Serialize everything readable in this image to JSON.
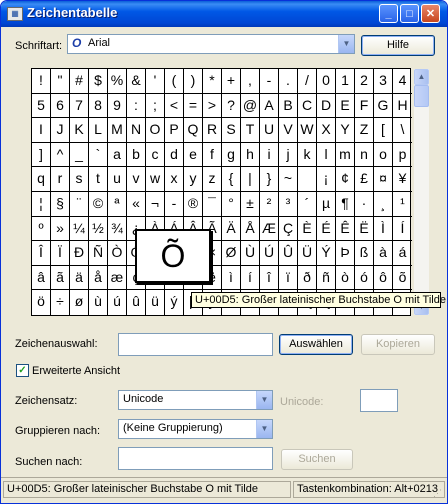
{
  "window": {
    "title": "Zeichentabelle"
  },
  "font_row": {
    "label": "Schriftart:",
    "font_icon": "O",
    "value": "Arial",
    "help_button": "Hilfe"
  },
  "grid": {
    "rows": [
      [
        "!",
        "\"",
        "#",
        "$",
        "%",
        "&",
        "'",
        "(",
        ")",
        "*",
        "+",
        ",",
        "-",
        ".",
        "/",
        "0",
        "1",
        "2",
        "3",
        "4"
      ],
      [
        "5",
        "6",
        "7",
        "8",
        "9",
        ":",
        ";",
        "<",
        "=",
        ">",
        "?",
        "@",
        "A",
        "B",
        "C",
        "D",
        "E",
        "F",
        "G",
        "H"
      ],
      [
        "I",
        "J",
        "K",
        "L",
        "M",
        "N",
        "O",
        "P",
        "Q",
        "R",
        "S",
        "T",
        "U",
        "V",
        "W",
        "X",
        "Y",
        "Z",
        "[",
        "\\"
      ],
      [
        "]",
        "^",
        "_",
        "`",
        "a",
        "b",
        "c",
        "d",
        "e",
        "f",
        "g",
        "h",
        "i",
        "j",
        "k",
        "l",
        "m",
        "n",
        "o",
        "p"
      ],
      [
        "q",
        "r",
        "s",
        "t",
        "u",
        "v",
        "w",
        "x",
        "y",
        "z",
        "{",
        "|",
        "}",
        "~",
        "",
        "¡",
        "¢",
        "£",
        "¤",
        "¥"
      ],
      [
        "¦",
        "§",
        "¨",
        "©",
        "ª",
        "«",
        "¬",
        "-",
        "®",
        "¯",
        "°",
        "±",
        "²",
        "³",
        "´",
        "µ",
        "¶",
        "·",
        "¸",
        "¹"
      ],
      [
        "º",
        "»",
        "¼",
        "½",
        "¾",
        "¿",
        "À",
        "Á",
        "Â",
        "Ã",
        "Ä",
        "Å",
        "Æ",
        "Ç",
        "È",
        "É",
        "Ê",
        "Ë",
        "Ì",
        "Í"
      ],
      [
        "Î",
        "Ï",
        "Ð",
        "Ñ",
        "Ò",
        "Ó",
        "Ô",
        "Õ",
        "Ö",
        "×",
        "Ø",
        "Ù",
        "Ú",
        "Û",
        "Ü",
        "Ý",
        "Þ",
        "ß",
        "à",
        "á"
      ],
      [
        "â",
        "ã",
        "ä",
        "å",
        "æ",
        "ç",
        "è",
        "é",
        "ê",
        "ë",
        "ì",
        "í",
        "î",
        "ï",
        "ð",
        "ñ",
        "ò",
        "ó",
        "ô",
        "õ"
      ],
      [
        "ö",
        "÷",
        "ø",
        "ù",
        "ú",
        "û",
        "ü",
        "ý",
        "þ",
        "ÿ",
        "Ā",
        "ā",
        "Ă",
        "ă",
        "Ą",
        "ą",
        "Ć",
        "ć",
        "Ĉ",
        "ĉ"
      ]
    ],
    "magnified_char": "Õ",
    "tooltip": "U+00D5: Großer lateinischer Buchstabe O mit Tilde"
  },
  "selection": {
    "label": "Zeichenauswahl:",
    "value": "",
    "select_button": "Auswählen",
    "copy_button": "Kopieren"
  },
  "advanced": {
    "label": "Erweiterte Ansicht",
    "checked": true
  },
  "charset": {
    "label": "Zeichensatz:",
    "value": "Unicode",
    "unicode_label": "Unicode:",
    "unicode_value": ""
  },
  "group": {
    "label": "Gruppieren nach:",
    "value": "(Keine Gruppierung)"
  },
  "search": {
    "label": "Suchen nach:",
    "value": "",
    "button": "Suchen"
  },
  "status": {
    "left": "U+00D5: Großer lateinischer Buchstabe O mit Tilde",
    "right": "Tastenkombination: Alt+0213"
  }
}
